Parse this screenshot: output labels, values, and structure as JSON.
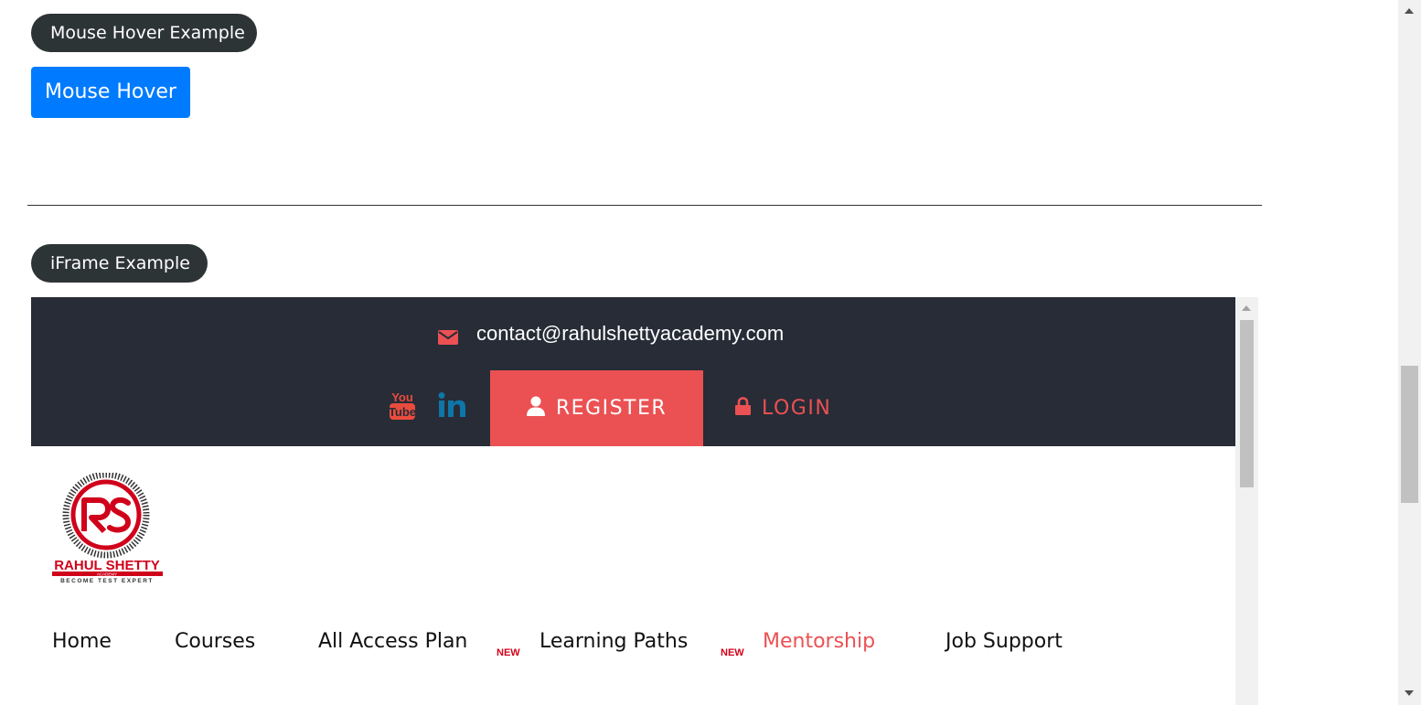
{
  "mouse_hover_section": {
    "legend": "Mouse Hover Example",
    "button_label": "Mouse Hover",
    "button_color": "#007bff"
  },
  "iframe_section": {
    "legend": "iFrame Example"
  },
  "embedded_site": {
    "contact_email": "contact@rahulshettyacademy.com",
    "social_icons": [
      "youtube-icon",
      "linkedin-icon"
    ],
    "register_label": "REGISTER",
    "login_label": "LOGIN",
    "accent_color": "#eb5153",
    "topbar_color": "#272c37",
    "logo": {
      "brand": "RAHUL SHETTY",
      "sub": "ACADEMY",
      "tagline": "BECOME TEST EXPERT"
    },
    "nav": [
      {
        "label": "Home"
      },
      {
        "label": "Courses"
      },
      {
        "label": "All Access Plan",
        "badge": "NEW"
      },
      {
        "label": "Learning Paths",
        "badge": "NEW"
      },
      {
        "label": "Mentorship",
        "active": true
      },
      {
        "label": "Job Support"
      }
    ]
  }
}
